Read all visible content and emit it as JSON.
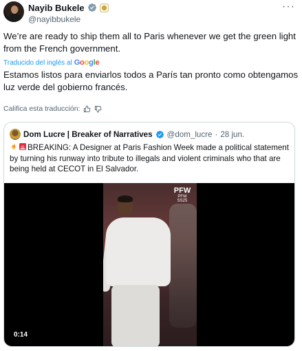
{
  "author": {
    "display_name": "Nayib Bukele",
    "handle": "@nayibbukele"
  },
  "tweet": {
    "text_en": "We’re are ready to ship them all to Paris whenever we get the green light from the French government.",
    "translated_label": "Traducido del inglés al",
    "translated_provider": "Google",
    "text_es": "Estamos listos para enviarlos todos a París tan pronto como obtengamos luz verde del gobierno francés.",
    "rate_translation": "Califica esta traducción:"
  },
  "quote": {
    "display_name": "Dom Lucre | Breaker of Narratives",
    "handle": "@dom_lucre",
    "separator": "·",
    "date": "28 jun.",
    "text": "BREAKING: A Designer at Paris Fashion Week made a political statement by turning his runway into tribute to illegals and violent criminals who that are being held at CECOT in El Salvador.",
    "video_time": "0:14",
    "video_brand": "PFW",
    "video_brand_caption": "PFW SS25"
  },
  "colors": {
    "accent": "#1d9bf0",
    "text": "#0f1419",
    "muted": "#536471",
    "border": "#cfd9de"
  }
}
